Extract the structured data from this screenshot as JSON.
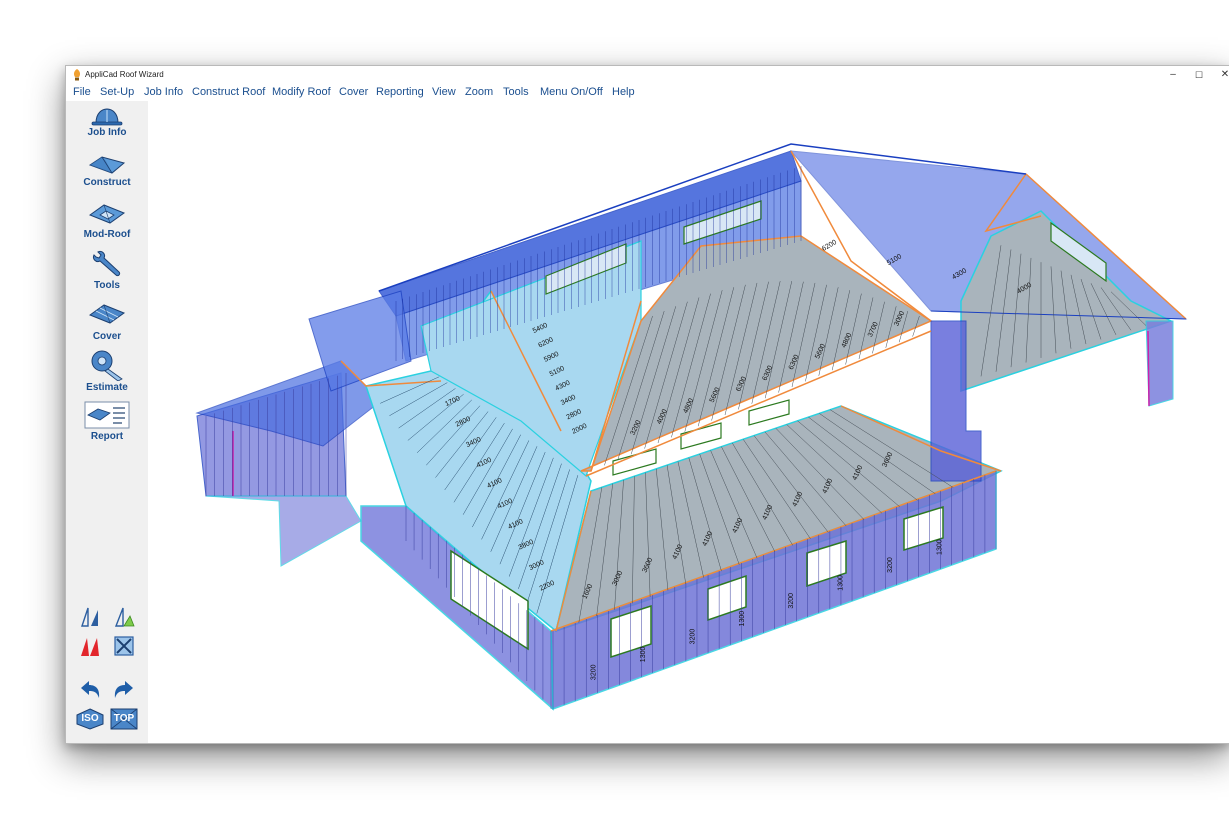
{
  "window": {
    "title": "AppliCad Roof Wizard",
    "minimize": "–",
    "maximize": "☐",
    "close": "✕"
  },
  "menu": [
    "File",
    "Set-Up",
    "Job Info",
    "Construct Roof",
    "Modify Roof",
    "Cover",
    "Reporting",
    "View",
    "Zoom",
    "Tools",
    "Menu On/Off",
    "Help"
  ],
  "sidebar": {
    "job_info": "Job Info",
    "construct": "Construct",
    "mod_roof": "Mod-Roof",
    "tools": "Tools",
    "cover": "Cover",
    "estimate": "Estimate",
    "report": "Report",
    "iso": "ISO",
    "top": "TOP"
  },
  "colors": {
    "menu_text": "#1b4f8f",
    "sidebar_text": "#1c4f8e",
    "wall_fill": "#6f74d6",
    "roof_light": "#a8d8f0",
    "roof_grey": "#a9b4bc",
    "fascia": "#2ad1e0",
    "hip_line": "#f08a3c",
    "edge_blue": "#1a3fc0"
  },
  "drawing": {
    "dims_front_walls": [
      "3200",
      "1300",
      "3200",
      "1300",
      "3200",
      "1300",
      "3200",
      "1300"
    ],
    "dims_left_roof": [
      "2200",
      "3000",
      "3800",
      "4100",
      "4100",
      "4100",
      "4100",
      "3400",
      "2800",
      "1700"
    ],
    "dims_front_roof": [
      "1600",
      "3000",
      "3600",
      "4100",
      "4100",
      "4100",
      "4100",
      "4100",
      "4100",
      "4100",
      "3600"
    ],
    "dims_back_roof": [
      "3200",
      "4000",
      "4800",
      "5600",
      "6300",
      "6300",
      "6300",
      "5600",
      "4800",
      "3700",
      "3000"
    ],
    "dims_upper_left_roof": [
      "5400",
      "6200",
      "5900",
      "5100",
      "4300",
      "3400",
      "2800",
      "2000"
    ],
    "dims_right_roof": [
      "6200",
      "5100",
      "4300",
      "4000"
    ]
  }
}
